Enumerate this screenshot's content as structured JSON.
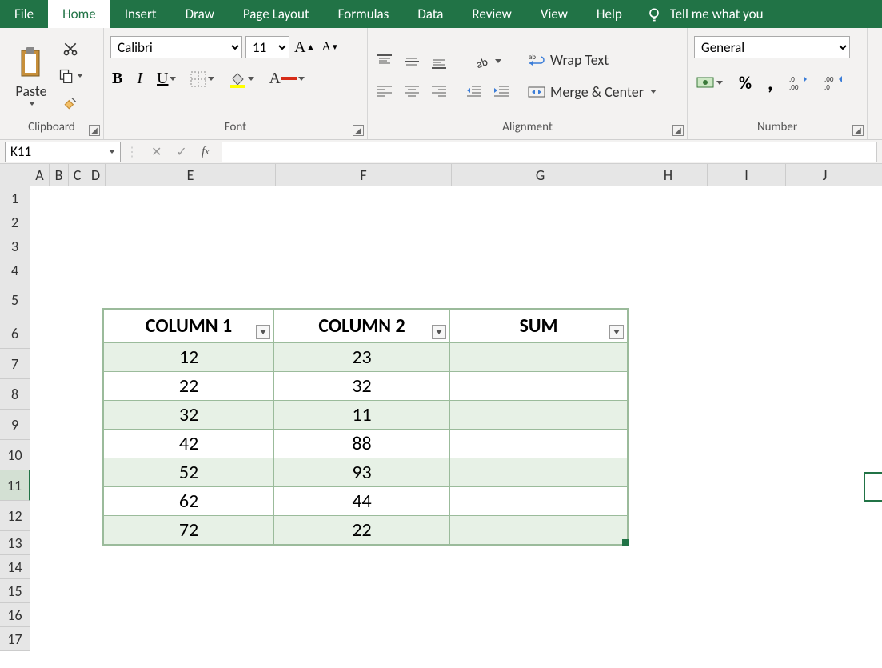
{
  "tabs": {
    "file": "File",
    "home": "Home",
    "insert": "Insert",
    "draw": "Draw",
    "page_layout": "Page Layout",
    "formulas": "Formulas",
    "data": "Data",
    "review": "Review",
    "view": "View",
    "help": "Help",
    "tell_me": "Tell me what you"
  },
  "clipboard": {
    "paste": "Paste",
    "label": "Clipboard"
  },
  "font": {
    "name": "Calibri",
    "size": "11",
    "label": "Font"
  },
  "alignment": {
    "wrap": "Wrap Text",
    "merge": "Merge & Center",
    "label": "Alignment"
  },
  "number": {
    "format": "General",
    "label": "Number"
  },
  "name_box": "K11",
  "columns": {
    "A": "A",
    "B": "B",
    "C": "C",
    "D": "D",
    "E": "E",
    "F": "F",
    "G": "G",
    "H": "H",
    "I": "I",
    "J": "J"
  },
  "rows": [
    "1",
    "2",
    "3",
    "4",
    "5",
    "6",
    "7",
    "8",
    "9",
    "10",
    "11",
    "12",
    "13",
    "14",
    "15",
    "16",
    "17"
  ],
  "table": {
    "headers": {
      "c1": "COLUMN 1",
      "c2": "COLUMN 2",
      "sum": "SUM"
    },
    "data": [
      {
        "c1": "12",
        "c2": "23",
        "sum": ""
      },
      {
        "c1": "22",
        "c2": "32",
        "sum": ""
      },
      {
        "c1": "32",
        "c2": "11",
        "sum": ""
      },
      {
        "c1": "42",
        "c2": "88",
        "sum": ""
      },
      {
        "c1": "52",
        "c2": "93",
        "sum": ""
      },
      {
        "c1": "62",
        "c2": "44",
        "sum": ""
      },
      {
        "c1": "72",
        "c2": "22",
        "sum": ""
      }
    ]
  }
}
